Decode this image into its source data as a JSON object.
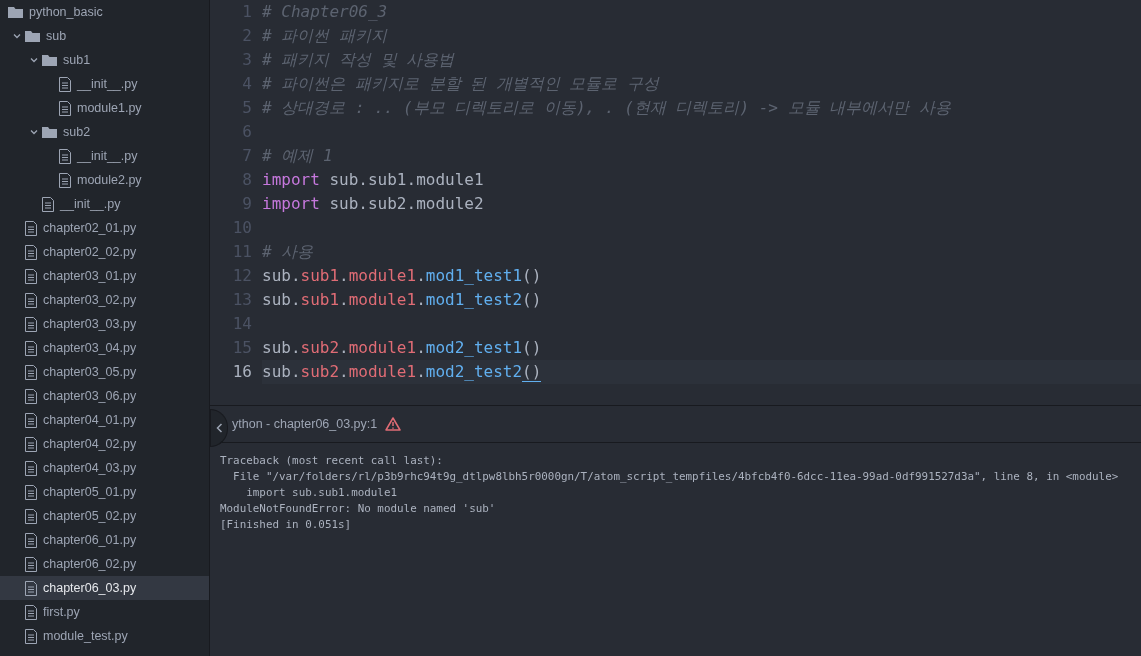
{
  "tree": [
    {
      "kind": "folder",
      "name": "python_basic",
      "selected": false,
      "children": [
        {
          "kind": "folder",
          "name": "sub",
          "expanded": true,
          "selected": false,
          "children": [
            {
              "kind": "folder",
              "name": "sub1",
              "expanded": true,
              "selected": false,
              "children": [
                {
                  "kind": "file",
                  "name": "__init__.py",
                  "selected": false
                },
                {
                  "kind": "file",
                  "name": "module1.py",
                  "selected": false
                }
              ]
            },
            {
              "kind": "folder",
              "name": "sub2",
              "expanded": true,
              "selected": false,
              "children": [
                {
                  "kind": "file",
                  "name": "__init__.py",
                  "selected": false
                },
                {
                  "kind": "file",
                  "name": "module2.py",
                  "selected": false
                }
              ]
            },
            {
              "kind": "file",
              "name": "__init__.py",
              "selected": false
            }
          ]
        },
        {
          "kind": "file",
          "name": "chapter02_01.py",
          "selected": false
        },
        {
          "kind": "file",
          "name": "chapter02_02.py",
          "selected": false
        },
        {
          "kind": "file",
          "name": "chapter03_01.py",
          "selected": false
        },
        {
          "kind": "file",
          "name": "chapter03_02.py",
          "selected": false
        },
        {
          "kind": "file",
          "name": "chapter03_03.py",
          "selected": false
        },
        {
          "kind": "file",
          "name": "chapter03_04.py",
          "selected": false
        },
        {
          "kind": "file",
          "name": "chapter03_05.py",
          "selected": false
        },
        {
          "kind": "file",
          "name": "chapter03_06.py",
          "selected": false
        },
        {
          "kind": "file",
          "name": "chapter04_01.py",
          "selected": false
        },
        {
          "kind": "file",
          "name": "chapter04_02.py",
          "selected": false
        },
        {
          "kind": "file",
          "name": "chapter04_03.py",
          "selected": false
        },
        {
          "kind": "file",
          "name": "chapter05_01.py",
          "selected": false
        },
        {
          "kind": "file",
          "name": "chapter05_02.py",
          "selected": false
        },
        {
          "kind": "file",
          "name": "chapter06_01.py",
          "selected": false
        },
        {
          "kind": "file",
          "name": "chapter06_02.py",
          "selected": false
        },
        {
          "kind": "file",
          "name": "chapter06_03.py",
          "selected": true
        },
        {
          "kind": "file",
          "name": "first.py",
          "selected": false
        },
        {
          "kind": "file",
          "name": "module_test.py",
          "selected": false
        }
      ]
    }
  ],
  "editor": {
    "lines": [
      {
        "number": "1",
        "current": false,
        "tokens": [
          {
            "kind": "comment",
            "text": "# Chapter06_3"
          }
        ]
      },
      {
        "number": "2",
        "current": false,
        "tokens": [
          {
            "kind": "comment",
            "text": "# 파이썬 패키지"
          }
        ]
      },
      {
        "number": "3",
        "current": false,
        "tokens": [
          {
            "kind": "comment",
            "text": "# 패키지 작성 및 사용법"
          }
        ]
      },
      {
        "number": "4",
        "current": false,
        "tokens": [
          {
            "kind": "comment",
            "text": "# 파이썬은 패키지로 분할 된 개별적인 모듈로 구성"
          }
        ]
      },
      {
        "number": "5",
        "current": false,
        "tokens": [
          {
            "kind": "comment",
            "text": "# 상대경로 : .. (부모 디렉토리로 이동), . (현재 디렉토리) -> 모듈 내부에서만 사용"
          }
        ]
      },
      {
        "number": "6",
        "current": false
      },
      {
        "number": "7",
        "current": false,
        "tokens": [
          {
            "kind": "comment",
            "text": "# 예제 1"
          }
        ]
      },
      {
        "number": "8",
        "current": false,
        "tokens": [
          {
            "kind": "keyword",
            "text": "import"
          },
          {
            "kind": "plain",
            "text": " sub.sub1.module1"
          }
        ]
      },
      {
        "number": "9",
        "current": false,
        "tokens": [
          {
            "kind": "keyword",
            "text": "import"
          },
          {
            "kind": "plain",
            "text": " sub.sub2.module2"
          }
        ]
      },
      {
        "number": "10",
        "current": false
      },
      {
        "number": "11",
        "current": false,
        "tokens": [
          {
            "kind": "comment",
            "text": "# 사용"
          }
        ]
      },
      {
        "number": "12",
        "current": false,
        "tokens": [
          {
            "kind": "plain",
            "text": "sub."
          },
          {
            "kind": "member",
            "text": "sub1"
          },
          {
            "kind": "plain",
            "text": "."
          },
          {
            "kind": "member",
            "text": "module1"
          },
          {
            "kind": "plain",
            "text": "."
          },
          {
            "kind": "function",
            "text": "mod1_test1"
          },
          {
            "kind": "plain",
            "text": "()"
          }
        ]
      },
      {
        "number": "13",
        "current": false,
        "tokens": [
          {
            "kind": "plain",
            "text": "sub."
          },
          {
            "kind": "member",
            "text": "sub1"
          },
          {
            "kind": "plain",
            "text": "."
          },
          {
            "kind": "member",
            "text": "module1"
          },
          {
            "kind": "plain",
            "text": "."
          },
          {
            "kind": "function",
            "text": "mod1_test2"
          },
          {
            "kind": "plain",
            "text": "()"
          }
        ]
      },
      {
        "number": "14",
        "current": false
      },
      {
        "number": "15",
        "current": false,
        "tokens": [
          {
            "kind": "plain",
            "text": "sub."
          },
          {
            "kind": "member",
            "text": "sub2"
          },
          {
            "kind": "plain",
            "text": "."
          },
          {
            "kind": "member",
            "text": "module1"
          },
          {
            "kind": "plain",
            "text": "."
          },
          {
            "kind": "function",
            "text": "mod2_test1"
          },
          {
            "kind": "plain",
            "text": "()"
          }
        ]
      },
      {
        "number": "16",
        "current": true,
        "tokens": [
          {
            "kind": "plain",
            "text": "sub."
          },
          {
            "kind": "member",
            "text": "sub2"
          },
          {
            "kind": "plain",
            "text": "."
          },
          {
            "kind": "member",
            "text": "module1"
          },
          {
            "kind": "plain",
            "text": "."
          },
          {
            "kind": "function",
            "text": "mod2_test2"
          },
          {
            "kind": "matched",
            "text": "()"
          }
        ]
      }
    ]
  },
  "output_panel": {
    "title": "ython - chapter06_03.py:1",
    "lines": [
      "Traceback (most recent call last):",
      "  File \"/var/folders/rl/p3b9rhc94t9g_dtlpw8lbh5r0000gn/T/atom_script_tempfiles/4bfcb4f0-6dcc-11ea-99ad-0df991527d3a\", line 8, in <module>",
      "    import sub.sub1.module1",
      "ModuleNotFoundError: No module named 'sub'",
      "[Finished in 0.051s]"
    ]
  }
}
